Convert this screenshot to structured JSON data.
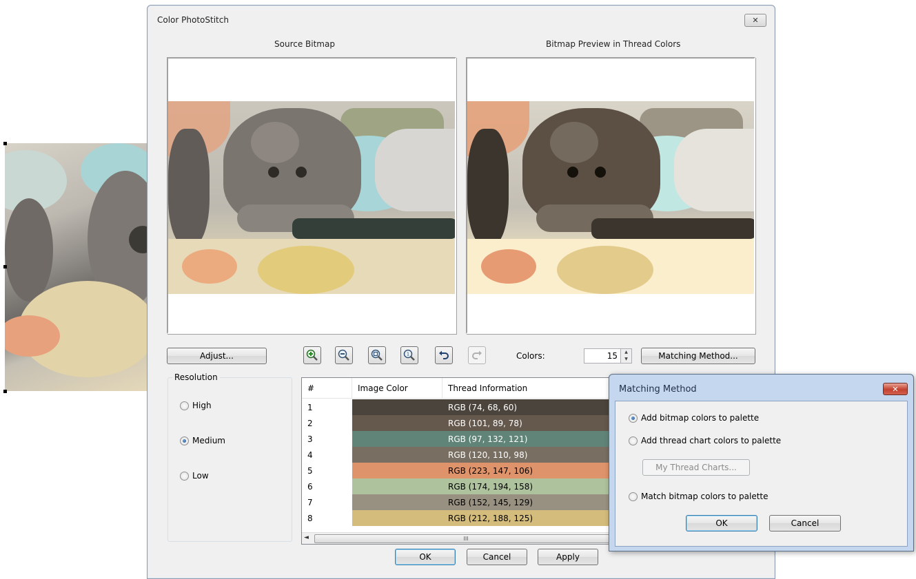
{
  "dialog": {
    "title": "Color PhotoStitch",
    "close_label": "✕",
    "source_label": "Source Bitmap",
    "preview_label": "Bitmap Preview in Thread Colors",
    "adjust_label": "Adjust...",
    "colors_label": "Colors:",
    "colors_value": "15",
    "matching_method_label": "Matching Method...",
    "resolution_title": "Resolution",
    "resolution_options": [
      "High",
      "Medium",
      "Low"
    ],
    "resolution_selected": "Medium",
    "ok_label": "OK",
    "cancel_label": "Cancel",
    "apply_label": "Apply"
  },
  "toolbar": {
    "icons": [
      "zoom-in-icon",
      "zoom-out-icon",
      "zoom-fit-icon",
      "zoom-actual-icon",
      "undo-icon",
      "redo-icon"
    ]
  },
  "table": {
    "headers": [
      "#",
      "Image Color",
      "Thread Information"
    ],
    "rows": [
      {
        "num": "1",
        "info": "RGB (74, 68, 60)",
        "color": "#4a443c"
      },
      {
        "num": "2",
        "info": "RGB (101, 89, 78)",
        "color": "#65594e"
      },
      {
        "num": "3",
        "info": "RGB (97, 132, 121)",
        "color": "#618479"
      },
      {
        "num": "4",
        "info": "RGB (120, 110, 98)",
        "color": "#786e62"
      },
      {
        "num": "5",
        "info": "RGB (223, 147, 106)",
        "color": "#df936a"
      },
      {
        "num": "6",
        "info": "RGB (174, 194, 158)",
        "color": "#aec29e"
      },
      {
        "num": "7",
        "info": "RGB (152, 145, 129)",
        "color": "#989181"
      },
      {
        "num": "8",
        "info": "RGB (212, 188, 125)",
        "color": "#d4bc7d"
      }
    ],
    "scroll_thumb": "III"
  },
  "matching": {
    "title": "Matching Method",
    "close_label": "✕",
    "options": [
      "Add bitmap colors to palette",
      "Add thread chart colors to palette",
      "Match bitmap colors to palette"
    ],
    "selected": "Add bitmap colors to palette",
    "thread_charts_label": "My Thread Charts...",
    "ok_label": "OK",
    "cancel_label": "Cancel"
  }
}
